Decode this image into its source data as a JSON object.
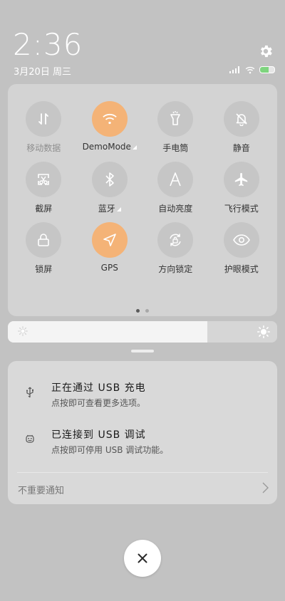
{
  "status": {
    "time": "2:36",
    "date": "3月20日 周三"
  },
  "icons": {
    "settings": "gear-icon",
    "signal": "signal-icon",
    "wifi": "wifi-icon",
    "battery": "battery-icon"
  },
  "quick_settings": {
    "tiles": [
      {
        "label": "移动数据",
        "icon": "mobile-data-icon",
        "active": false,
        "dim": true
      },
      {
        "label": "DemoMode",
        "icon": "wifi-icon",
        "active": true,
        "dim": false
      },
      {
        "label": "手电筒",
        "icon": "flashlight-icon",
        "active": false,
        "dim": false
      },
      {
        "label": "静音",
        "icon": "silent-icon",
        "active": false,
        "dim": false
      },
      {
        "label": "截屏",
        "icon": "screenshot-icon",
        "active": false,
        "dim": false
      },
      {
        "label": "蓝牙",
        "icon": "bluetooth-icon",
        "active": false,
        "dim": false
      },
      {
        "label": "自动亮度",
        "icon": "auto-brightness-icon",
        "active": false,
        "dim": false
      },
      {
        "label": "飞行模式",
        "icon": "airplane-icon",
        "active": false,
        "dim": false
      },
      {
        "label": "锁屏",
        "icon": "lock-icon",
        "active": false,
        "dim": false
      },
      {
        "label": "GPS",
        "icon": "gps-icon",
        "active": true,
        "dim": false
      },
      {
        "label": "方向锁定",
        "icon": "rotation-lock-icon",
        "active": false,
        "dim": false
      },
      {
        "label": "护眼模式",
        "icon": "eye-icon",
        "active": false,
        "dim": false
      }
    ],
    "page_count": 2,
    "current_page": 1,
    "active_color": "#f4b377"
  },
  "brightness": {
    "level": 0.74
  },
  "notifications": [
    {
      "title": "正在通过 USB 充电",
      "subtitle": "点按即可查看更多选项。",
      "icon": "usb-icon"
    },
    {
      "title": "已连接到 USB 调试",
      "subtitle": "点按即可停用 USB 调试功能。",
      "icon": "android-debug-icon"
    }
  ],
  "unimportant": {
    "label": "不重要通知"
  },
  "close": {
    "icon": "close-icon"
  }
}
